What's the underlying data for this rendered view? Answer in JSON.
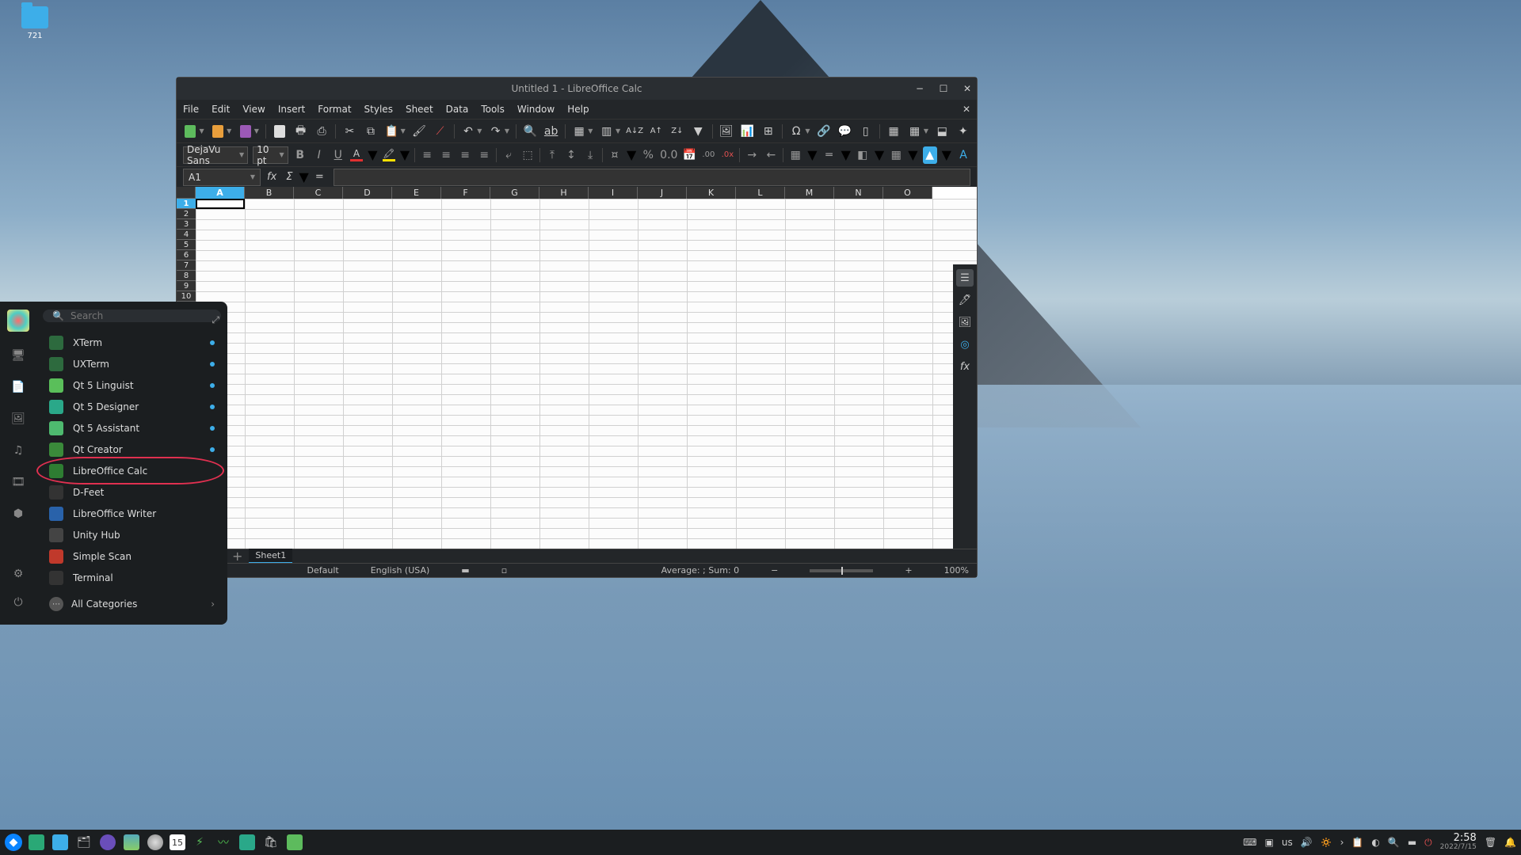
{
  "desktop": {
    "folder_label": "721"
  },
  "window": {
    "title": "Untitled 1 - LibreOffice Calc",
    "menus": [
      "File",
      "Edit",
      "View",
      "Insert",
      "Format",
      "Styles",
      "Sheet",
      "Data",
      "Tools",
      "Window",
      "Help"
    ],
    "font_name": "DejaVu Sans",
    "font_size": "10 pt",
    "cell_ref": "A1",
    "columns": [
      "A",
      "B",
      "C",
      "D",
      "E",
      "F",
      "G",
      "H",
      "I",
      "J",
      "K",
      "L",
      "M",
      "N",
      "O"
    ],
    "rows": [
      "1",
      "2",
      "3",
      "4",
      "5",
      "6",
      "7",
      "8",
      "9",
      "10"
    ],
    "sheet_tab": "Sheet1",
    "status_default": "Default",
    "status_lang": "English (USA)",
    "status_stats": "Average: ; Sum: 0",
    "zoom": "100%"
  },
  "launcher": {
    "search_placeholder": "Search",
    "apps": [
      {
        "name": "XTerm",
        "color": "#2d6a3e",
        "dot": true
      },
      {
        "name": "UXTerm",
        "color": "#2d6a3e",
        "dot": true
      },
      {
        "name": "Qt 5 Linguist",
        "color": "#5abf5a",
        "dot": true
      },
      {
        "name": "Qt 5 Designer",
        "color": "#2aa889",
        "dot": true
      },
      {
        "name": "Qt 5 Assistant",
        "color": "#4eba6f",
        "dot": true
      },
      {
        "name": "Qt Creator",
        "color": "#3a8a3a",
        "dot": true
      },
      {
        "name": "LibreOffice Calc",
        "color": "#2e7d32",
        "dot": false,
        "highlight": true
      },
      {
        "name": "D-Feet",
        "color": "#333",
        "dot": false
      },
      {
        "name": "LibreOffice Writer",
        "color": "#2962aa",
        "dot": false
      },
      {
        "name": "Unity Hub",
        "color": "#444",
        "dot": false
      },
      {
        "name": "Simple Scan",
        "color": "#c0392b",
        "dot": false
      },
      {
        "name": "Terminal",
        "color": "#333",
        "dot": false
      }
    ],
    "all_categories": "All Categories"
  },
  "taskbar": {
    "kb_layout": "us",
    "time": "2:58",
    "date": "2022/7/15",
    "calendar_day": "15"
  }
}
